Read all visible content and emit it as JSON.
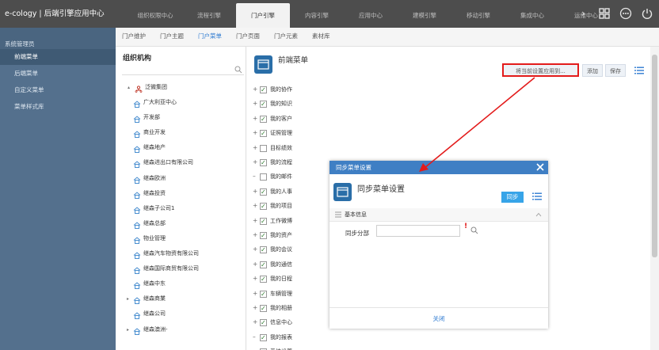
{
  "app": {
    "title": "e-cology | 后端引擎应用中心"
  },
  "top_nav": {
    "tabs": [
      "组织权限中心",
      "流程引擎",
      "门户引擎",
      "内容引擎",
      "应用中心",
      "建模引擎",
      "移动引擎",
      "集成中心",
      "运维中心"
    ],
    "active": "门户引擎",
    "more": "›",
    "icons": [
      "grid-icon",
      "more-icon",
      "power-icon"
    ]
  },
  "sidebar": {
    "user": "系统管理员",
    "items": [
      "前端菜单",
      "后端菜单",
      "自定义菜单",
      "菜单样式库"
    ],
    "active": "前端菜单"
  },
  "sub_tabs": {
    "items": [
      "门户维护",
      "门户主题",
      "门户菜单",
      "门户页面",
      "门户元素",
      "素材库"
    ],
    "active": "门户菜单"
  },
  "org_panel": {
    "title": "组织机构",
    "root": "泛微集团",
    "items": [
      "广大利亚中心",
      "开发部",
      "商业开发",
      "继森地产",
      "继森进出口有限公司",
      "继森欧洲",
      "继森投资",
      "继森子公司1",
      "继森总部",
      "物业管理",
      "继森汽车物资有限公司",
      "继森国际商贸有限公司",
      "继森中东",
      "继森商業",
      "继森公司",
      "继森澳洲-"
    ]
  },
  "menu_panel": {
    "title": "前端菜单",
    "apply_button": "将当前设置应用到...",
    "add_button": "添加",
    "save_button": "保存",
    "items": [
      {
        "label": "我的协作",
        "checked": true,
        "expand": "+"
      },
      {
        "label": "我的知识",
        "checked": true,
        "expand": "+"
      },
      {
        "label": "我的客户",
        "checked": true,
        "expand": "+"
      },
      {
        "label": "证照管理",
        "checked": true,
        "expand": "+"
      },
      {
        "label": "目标绩效",
        "checked": false,
        "expand": "+"
      },
      {
        "label": "我的流程",
        "checked": true,
        "expand": "+"
      },
      {
        "label": "我的邮件",
        "checked": false,
        "expand": "–"
      },
      {
        "label": "我的人事",
        "checked": true,
        "expand": "+"
      },
      {
        "label": "我的项目",
        "checked": true,
        "expand": "+"
      },
      {
        "label": "工作微博",
        "checked": true,
        "expand": "+"
      },
      {
        "label": "我的资产",
        "checked": true,
        "expand": "+"
      },
      {
        "label": "我的会议",
        "checked": true,
        "expand": "+"
      },
      {
        "label": "我的通信",
        "checked": true,
        "expand": "+"
      },
      {
        "label": "我的日程",
        "checked": true,
        "expand": "+"
      },
      {
        "label": "车辆管理",
        "checked": true,
        "expand": "+"
      },
      {
        "label": "我的相册",
        "checked": true,
        "expand": "+"
      },
      {
        "label": "信息中心",
        "checked": true,
        "expand": "+"
      },
      {
        "label": "我的报表",
        "checked": true,
        "expand": "–"
      },
      {
        "label": "系统设置",
        "checked": true,
        "expand": "–"
      }
    ]
  },
  "dialog": {
    "titlebar": "同步菜单设置",
    "title": "同步菜单设置",
    "sync_button": "同步",
    "section": "基本信息",
    "field_label": "同步分部",
    "field_value": "",
    "required_mark": "!",
    "close_button": "关闭"
  },
  "colors": {
    "topbar": "#4d4d4d",
    "sidebar": "#54708d",
    "accent": "#2f7bd1",
    "dialog_titlebar": "#3f7fc4",
    "highlight": "#e31b1b"
  }
}
